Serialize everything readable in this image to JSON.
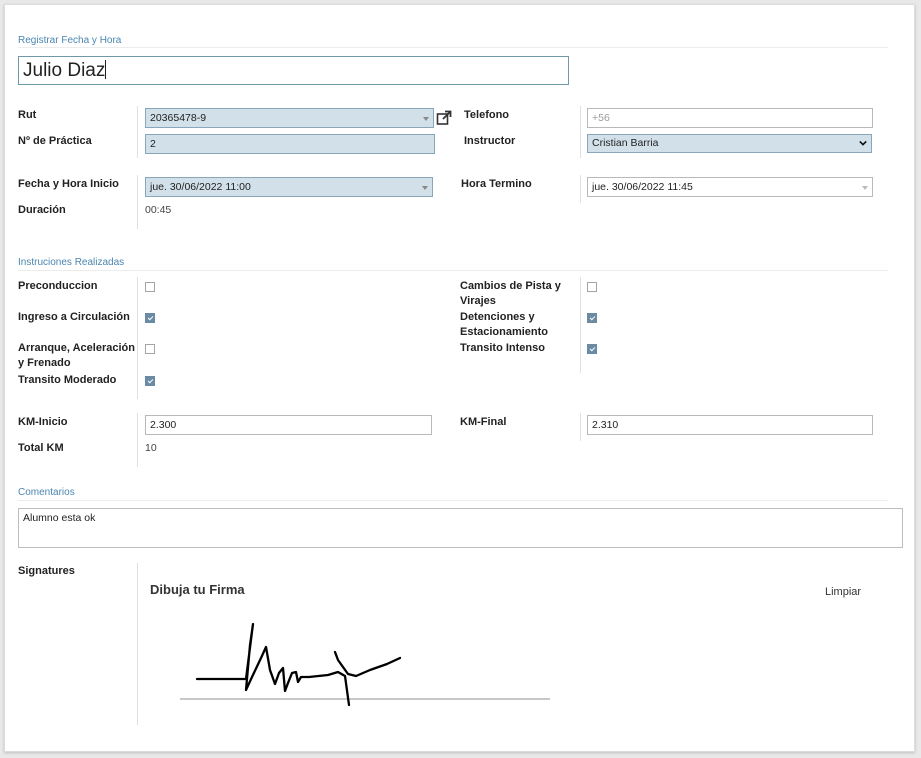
{
  "section_register": "Registrar Fecha y Hora",
  "student_name": "Julio Diaz",
  "labels": {
    "rut": "Rut",
    "practica": "Nº de Práctica",
    "telefono": "Telefono",
    "instructor": "Instructor",
    "fecha_inicio": "Fecha y Hora Inicio",
    "hora_termino": "Hora Termino",
    "duracion": "Duración"
  },
  "values": {
    "rut": "20365478-9",
    "practica": "2",
    "telefono_placeholder": "+56",
    "instructor": "Cristian Barria",
    "fecha_inicio": "jue. 30/06/2022 11:00",
    "hora_termino": "jue. 30/06/2022 11:45",
    "duracion": "00:45"
  },
  "section_instructions": "Instruciones Realizadas",
  "instructions_left": [
    {
      "label_lines": [
        "Preconduccion"
      ],
      "checked": false
    },
    {
      "label_lines": [
        "Ingreso a Circulación"
      ],
      "checked": true
    },
    {
      "label_lines": [
        "Arranque, Aceleración",
        "y Frenado"
      ],
      "checked": false
    },
    {
      "label_lines": [
        "Transito Moderado"
      ],
      "checked": true
    }
  ],
  "instructions_right": [
    {
      "label_lines": [
        "Cambios de Pista y",
        "Virajes"
      ],
      "checked": false
    },
    {
      "label_lines": [
        "Detenciones y",
        "Estacionamiento"
      ],
      "checked": true
    },
    {
      "label_lines": [
        "Transito Intenso"
      ],
      "checked": true
    }
  ],
  "km": {
    "inicio_label": "KM-Inicio",
    "inicio_value": "2.300",
    "final_label": "KM-Final",
    "final_value": "2.310",
    "total_label": "Total KM",
    "total_value": "10"
  },
  "section_comments": "Comentarios",
  "comment": "Alumno esta ok",
  "signatures": {
    "label": "Signatures",
    "title": "Dibuja tu Firma",
    "clear_label": "Limpiar"
  },
  "colors": {
    "accent": "#4a86b0",
    "required_bg": "#d2e0ea",
    "checkbox_on": "#6b8ba4"
  }
}
